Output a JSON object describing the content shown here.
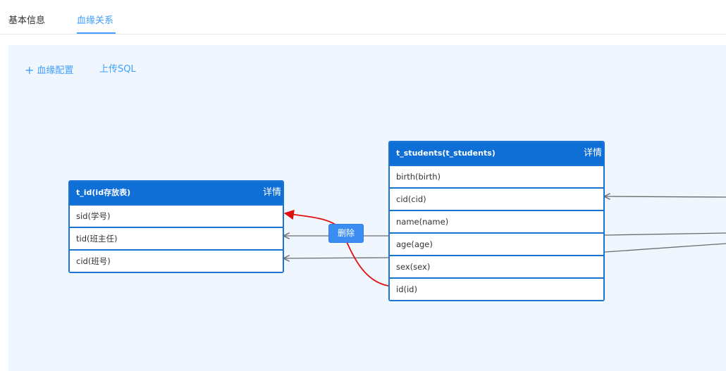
{
  "tabs": [
    {
      "label": "基本信息",
      "active": false
    },
    {
      "label": "血缘关系",
      "active": true
    }
  ],
  "toolbar": {
    "config_label": "血缘配置",
    "upload_label": "上传SQL"
  },
  "tables": {
    "t_id": {
      "title": "t_id(id存放表)",
      "detail_label": "详情",
      "fields": [
        "sid(学号)",
        "tid(班主任)",
        "cid(班号)"
      ]
    },
    "t_students": {
      "title": "t_students(t_students)",
      "detail_label": "详情",
      "fields": [
        "birth(birth)",
        "cid(cid)",
        "name(name)",
        "age(age)",
        "sex(sex)",
        "id(id)"
      ]
    }
  },
  "edge_actions": {
    "delete_label": "删除"
  },
  "colors": {
    "accent": "#409eff",
    "header_blue": "#0f6fd7",
    "canvas_bg": "#f0f6fe",
    "edge_gray": "#6b6b6b",
    "edge_selected": "#e01010"
  }
}
